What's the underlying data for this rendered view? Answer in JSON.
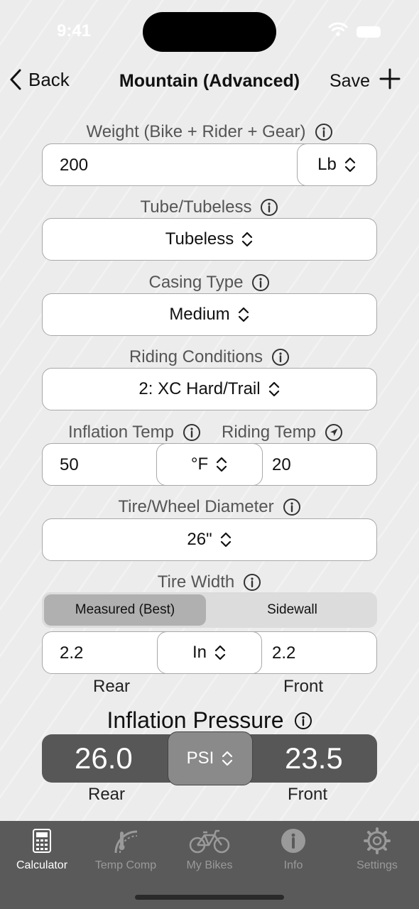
{
  "status": {
    "time": "9:41"
  },
  "nav": {
    "back_label": "Back",
    "title": "Mountain (Advanced)",
    "save_label": "Save"
  },
  "weight": {
    "label": "Weight (Bike + Rider + Gear)",
    "value": "200",
    "unit": "Lb"
  },
  "tube": {
    "label": "Tube/Tubeless",
    "value": "Tubeless"
  },
  "casing": {
    "label": "Casing Type",
    "value": "Medium"
  },
  "conditions": {
    "label": "Riding Conditions",
    "value": "2: XC Hard/Trail"
  },
  "temp": {
    "inflation_label": "Inflation Temp",
    "riding_label": "Riding Temp",
    "inflation_value": "50",
    "unit": "°F",
    "riding_value": "20"
  },
  "diameter": {
    "label": "Tire/Wheel Diameter",
    "value": "26\""
  },
  "width": {
    "label": "Tire Width",
    "segments": [
      "Measured (Best)",
      "Sidewall"
    ],
    "selected_segment": "Measured (Best)",
    "rear_value": "2.2",
    "unit": "In",
    "front_value": "2.2",
    "rear_label": "Rear",
    "front_label": "Front"
  },
  "result": {
    "title": "Inflation Pressure",
    "rear_value": "26.0",
    "unit": "PSI",
    "front_value": "23.5",
    "rear_label": "Rear",
    "front_label": "Front"
  },
  "tabs": [
    {
      "label": "Calculator",
      "icon": "calculator-icon",
      "active": true
    },
    {
      "label": "Temp Comp",
      "icon": "thermometer-gauge-icon",
      "active": false
    },
    {
      "label": "My Bikes",
      "icon": "bicycle-icon",
      "active": false
    },
    {
      "label": "Info",
      "icon": "info-icon",
      "active": false
    },
    {
      "label": "Settings",
      "icon": "gear-icon",
      "active": false
    }
  ]
}
